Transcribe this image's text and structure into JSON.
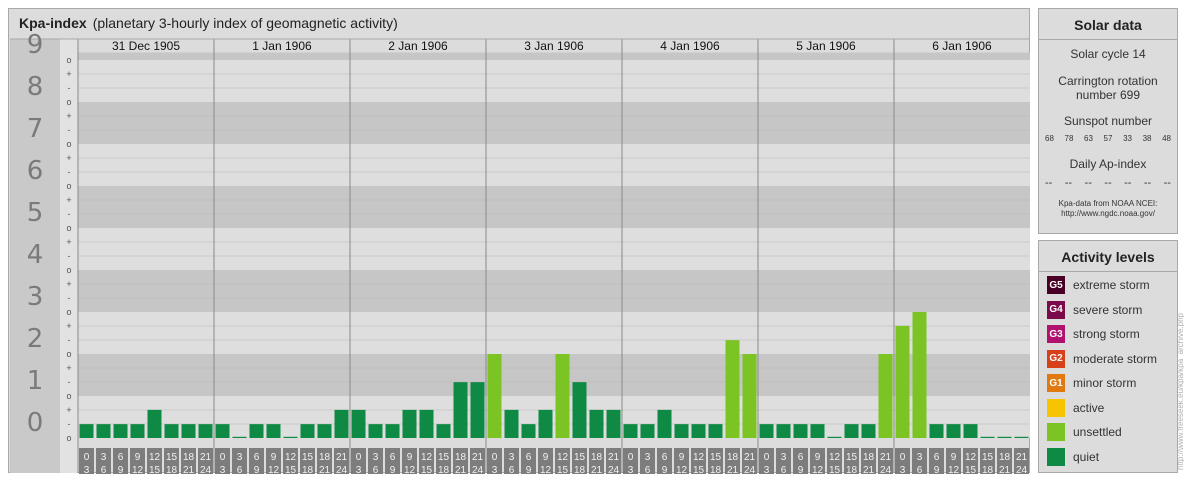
{
  "header": {
    "title": "Kpa-index",
    "subtitle": "(planetary 3-hourly index of geomagnetic activity)"
  },
  "solar": {
    "heading": "Solar data",
    "cycle": "Solar cycle 14",
    "carrington_line1": "Carrington rotation",
    "carrington_line2": "number 699",
    "sunspot_heading": "Sunspot number",
    "sunspots": [
      "68",
      "78",
      "63",
      "57",
      "33",
      "38",
      "48"
    ],
    "ap_heading": "Daily Ap-index",
    "ap_values": [
      "--",
      "--",
      "--",
      "--",
      "--",
      "--",
      "--"
    ],
    "source_line1": "Kpa-data from NOAA NCEI:",
    "source_line2": "http://www.ngdc.noaa.gov/"
  },
  "activity": {
    "heading": "Activity levels",
    "levels": [
      {
        "badge": "G5",
        "label": "extreme storm",
        "color": "#4a0024"
      },
      {
        "badge": "G4",
        "label": "severe storm",
        "color": "#7a0a4a"
      },
      {
        "badge": "G3",
        "label": "strong storm",
        "color": "#b0126e"
      },
      {
        "badge": "G2",
        "label": "moderate storm",
        "color": "#d8401a"
      },
      {
        "badge": "G1",
        "label": "minor storm",
        "color": "#e07a10"
      },
      {
        "badge": "",
        "label": "active",
        "color": "#f6c400"
      },
      {
        "badge": "",
        "label": "unsettled",
        "color": "#7bc424"
      },
      {
        "badge": "",
        "label": "quiet",
        "color": "#0f8a44"
      }
    ]
  },
  "watermark": "http://www.freeseek.eu/kpa/kpa_archive.php",
  "chart_data": {
    "type": "bar",
    "title": "Kpa-index",
    "subtitle": "(planetary 3-hourly index of geomagnetic activity)",
    "ylim": [
      0,
      9.67
    ],
    "y_ticks": [
      "0",
      "1",
      "2",
      "3",
      "4",
      "5",
      "6",
      "7",
      "8",
      "9"
    ],
    "y_minor_labels": [
      "+",
      "o",
      "-"
    ],
    "days": [
      "31 Dec 1905",
      "1 Jan 1906",
      "2 Jan 1906",
      "3 Jan 1906",
      "4 Jan 1906",
      "5 Jan 1906",
      "6 Jan 1906"
    ],
    "interval_labels": [
      [
        "0",
        "3"
      ],
      [
        "3",
        "6"
      ],
      [
        "6",
        "9"
      ],
      [
        "9",
        "12"
      ],
      [
        "12",
        "15"
      ],
      [
        "15",
        "18"
      ],
      [
        "18",
        "21"
      ],
      [
        "21",
        "24"
      ]
    ],
    "series": [
      {
        "values": [
          0.33,
          0.33,
          0.33,
          0.33,
          0.67,
          0.33,
          0.33,
          0.33,
          0.33,
          0,
          0.33,
          0.33,
          0,
          0.33,
          0.33,
          0.67,
          0.67,
          0.33,
          0.33,
          0.67,
          0.67,
          0.33,
          1.33,
          1.33,
          2,
          0.67,
          0.33,
          0.67,
          2,
          1.33,
          0.67,
          0.67,
          0.33,
          0.33,
          0.67,
          0.33,
          0.33,
          0.33,
          2.33,
          2,
          0.33,
          0.33,
          0.33,
          0.33,
          0,
          0.33,
          0.33,
          2,
          2.67,
          3,
          0.33,
          0.33,
          0.33,
          0,
          0,
          0
        ]
      }
    ],
    "level_colors": {
      "quiet": "#0f8a44",
      "unsettled": "#7bc424",
      "active": "#f6c400"
    },
    "grid": true
  }
}
